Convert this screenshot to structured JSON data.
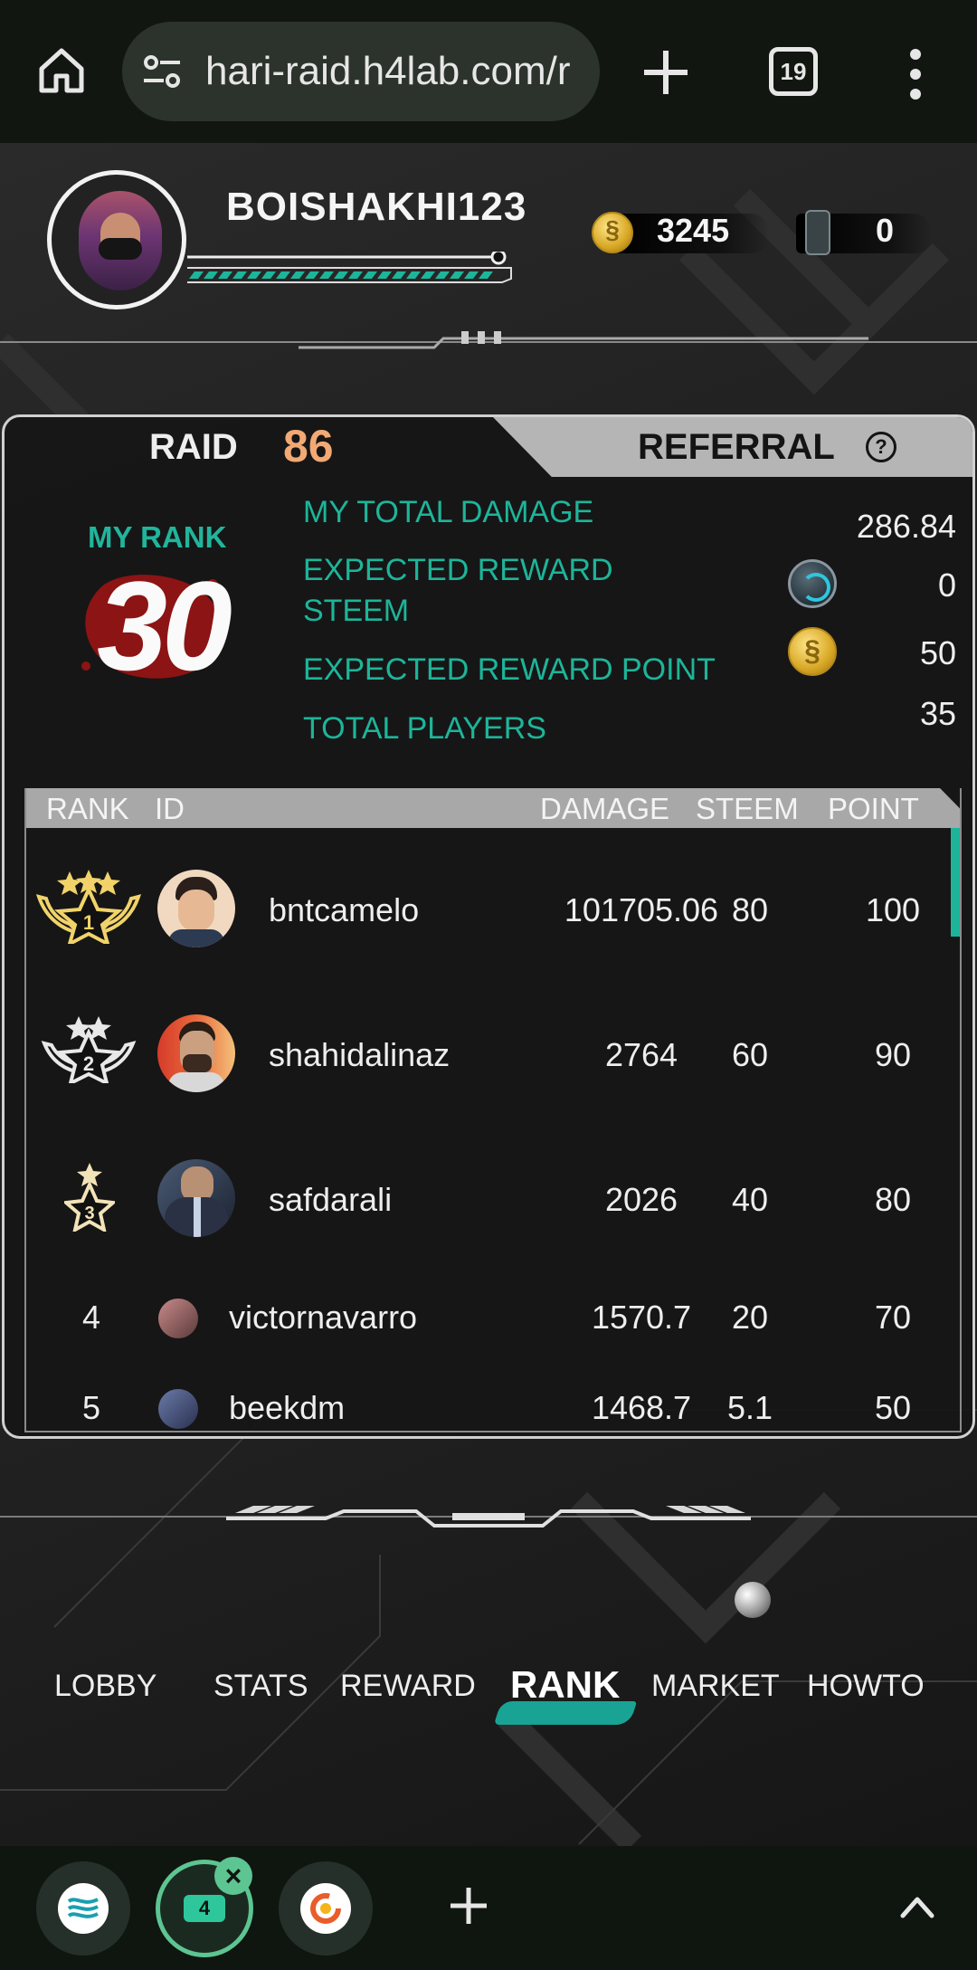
{
  "browser": {
    "url": "hari-raid.h4lab.com/r",
    "tab_count": "19"
  },
  "profile": {
    "username": "BOISHAKHI123",
    "coins": "3245",
    "gems": "0"
  },
  "tabs": {
    "raid_label": "RAID",
    "raid_number": "86",
    "referral_label": "REFERRAL",
    "help": "?"
  },
  "summary": {
    "my_rank_label": "MY RANK",
    "my_rank": "30",
    "total_damage_label": "MY TOTAL DAMAGE",
    "total_damage": "286.84",
    "reward_steem_label_1": "EXPECTED REWARD",
    "reward_steem_label_2": "STEEM",
    "reward_steem": "0",
    "reward_point_label": "EXPECTED REWARD POINT",
    "reward_point": "50",
    "total_players_label": "TOTAL PLAYERS",
    "total_players": "35"
  },
  "table": {
    "headers": {
      "rank": "RANK",
      "id": "ID",
      "damage": "DAMAGE",
      "steem": "STEEM",
      "point": "POINT"
    },
    "rows": [
      {
        "rank": "1",
        "id": "bntcamelo",
        "damage": "101705.06",
        "steem": "80",
        "point": "100"
      },
      {
        "rank": "2",
        "id": "shahidalinaz",
        "damage": "2764",
        "steem": "60",
        "point": "90"
      },
      {
        "rank": "3",
        "id": "safdarali",
        "damage": "2026",
        "steem": "40",
        "point": "80"
      },
      {
        "rank": "4",
        "id": "victornavarro",
        "damage": "1570.7",
        "steem": "20",
        "point": "70"
      },
      {
        "rank": "5",
        "id": "beekdm",
        "damage": "1468.7",
        "steem": "5.1",
        "point": "50"
      }
    ]
  },
  "nav": {
    "items": [
      "LOBBY",
      "STATS",
      "REWARD",
      "RANK",
      "MARKET",
      "HOWTO"
    ],
    "active": "RANK"
  },
  "colors": {
    "accent_teal": "#1db59a",
    "raid_orange": "#f2a974",
    "gold": "#d8a825"
  }
}
